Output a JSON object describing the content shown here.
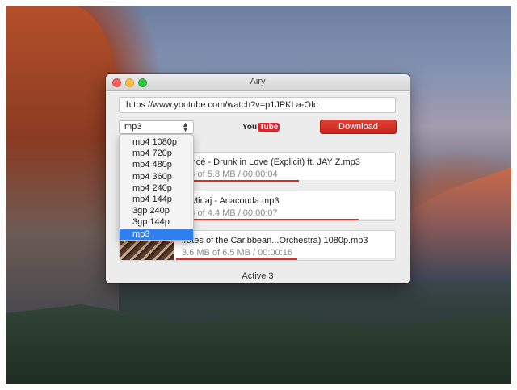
{
  "window": {
    "title": "Airy"
  },
  "url_field": {
    "value": "https://www.youtube.com/watch?v=p1JPKLa-Ofc"
  },
  "format_select": {
    "value": "mp3",
    "options": [
      "mp4 1080p",
      "mp4 720p",
      "mp4 480p",
      "mp4 360p",
      "mp4 240p",
      "mp4 144p",
      "3gp 240p",
      "3gp 144p",
      "mp3"
    ],
    "selected_index": 8
  },
  "logo": {
    "you": "You",
    "tube": "Tube"
  },
  "download_button": {
    "label": "Download"
  },
  "downloads": [
    {
      "name": "yoncé - Drunk in Love (Explicit) ft. JAY Z.mp3",
      "progress_text": "MB of 5.8 MB / 00:00:04",
      "progress": 0.56
    },
    {
      "name": "ki Minaj - Anaconda.mp3",
      "progress_text": "MB of 4.4 MB / 00:00:07",
      "progress": 0.83
    },
    {
      "name": "irates of the Caribbean...Orchestra) 1080p.mp3",
      "progress_text": "3.6 MB of 6.5 MB / 00:00:16",
      "progress": 0.55
    }
  ],
  "status": {
    "text": "Active 3"
  },
  "colors": {
    "accent": "#d0302a",
    "selection": "#2f7ff0"
  }
}
